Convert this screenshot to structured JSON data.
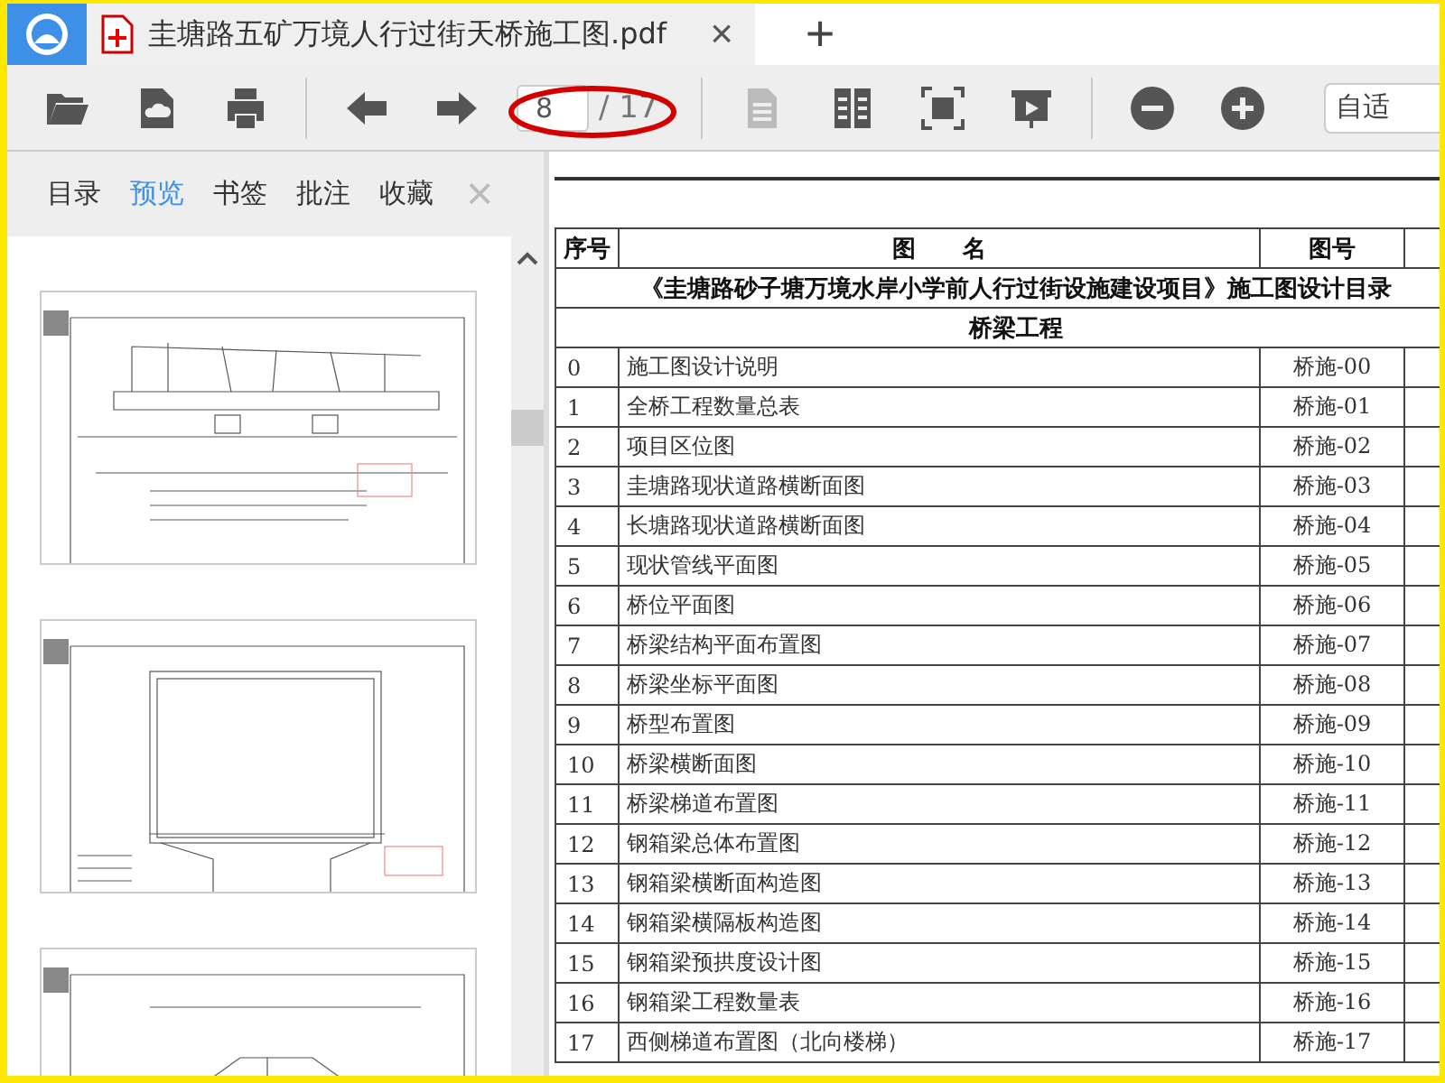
{
  "tab": {
    "title": "圭塘路五矿万境人行过街天桥施工图.pdf",
    "close": "×"
  },
  "new_tab": "+",
  "toolbar": {
    "groups": [
      {
        "buttons": [
          {
            "kind": "open",
            "disabled": false
          },
          {
            "kind": "cloud",
            "disabled": false
          },
          {
            "kind": "print",
            "disabled": false
          }
        ]
      },
      {
        "buttons": [
          {
            "kind": "back",
            "disabled": false
          },
          {
            "kind": "forward",
            "disabled": false
          }
        ],
        "page": {
          "value": "8",
          "total": "/ 17"
        }
      },
      {
        "buttons": [
          {
            "kind": "single",
            "disabled": true
          },
          {
            "kind": "double",
            "disabled": false
          },
          {
            "kind": "fullscreen",
            "disabled": false
          },
          {
            "kind": "present",
            "disabled": false
          }
        ]
      },
      {
        "buttons": [
          {
            "kind": "zoom-out",
            "disabled": false
          },
          {
            "kind": "zoom-in",
            "disabled": false
          }
        ],
        "zoom": "自适"
      }
    ]
  },
  "sidebar": {
    "tabs": [
      {
        "label": "目录",
        "selected": false
      },
      {
        "label": "预览",
        "selected": true
      },
      {
        "label": "书签",
        "selected": false
      },
      {
        "label": "批注",
        "selected": false
      },
      {
        "label": "收藏",
        "selected": false
      }
    ],
    "close": "×",
    "thumbnails": [
      {
        "kind": "elevation"
      },
      {
        "kind": "section"
      },
      {
        "kind": "ramp"
      }
    ]
  },
  "table": {
    "columns": [
      "序号",
      "图　　名",
      "图号"
    ],
    "title": "《圭塘路砂子塘万境水岸小学前人行过街设施建设项目》施工图设计目录",
    "section": "桥梁工程",
    "rows": [
      {
        "no": "0",
        "name": "施工图设计说明",
        "code": "桥施-00"
      },
      {
        "no": "1",
        "name": "全桥工程数量总表",
        "code": "桥施-01"
      },
      {
        "no": "2",
        "name": "项目区位图",
        "code": "桥施-02"
      },
      {
        "no": "3",
        "name": "圭塘路现状道路横断面图",
        "code": "桥施-03"
      },
      {
        "no": "4",
        "name": "长塘路现状道路横断面图",
        "code": "桥施-04"
      },
      {
        "no": "5",
        "name": "现状管线平面图",
        "code": "桥施-05"
      },
      {
        "no": "6",
        "name": "桥位平面图",
        "code": "桥施-06"
      },
      {
        "no": "7",
        "name": "桥梁结构平面布置图",
        "code": "桥施-07"
      },
      {
        "no": "8",
        "name": "桥梁坐标平面图",
        "code": "桥施-08"
      },
      {
        "no": "9",
        "name": "桥型布置图",
        "code": "桥施-09"
      },
      {
        "no": "10",
        "name": "桥梁横断面图",
        "code": "桥施-10"
      },
      {
        "no": "11",
        "name": "桥梁梯道布置图",
        "code": "桥施-11"
      },
      {
        "no": "12",
        "name": "钢箱梁总体布置图",
        "code": "桥施-12"
      },
      {
        "no": "13",
        "name": "钢箱梁横断面构造图",
        "code": "桥施-13"
      },
      {
        "no": "14",
        "name": "钢箱梁横隔板构造图",
        "code": "桥施-14"
      },
      {
        "no": "15",
        "name": "钢箱梁预拱度设计图",
        "code": "桥施-15"
      },
      {
        "no": "16",
        "name": "钢箱梁工程数量表",
        "code": "桥施-16"
      },
      {
        "no": "17",
        "name": "西侧梯道布置图（北向楼梯）",
        "code": "桥施-17"
      }
    ]
  }
}
